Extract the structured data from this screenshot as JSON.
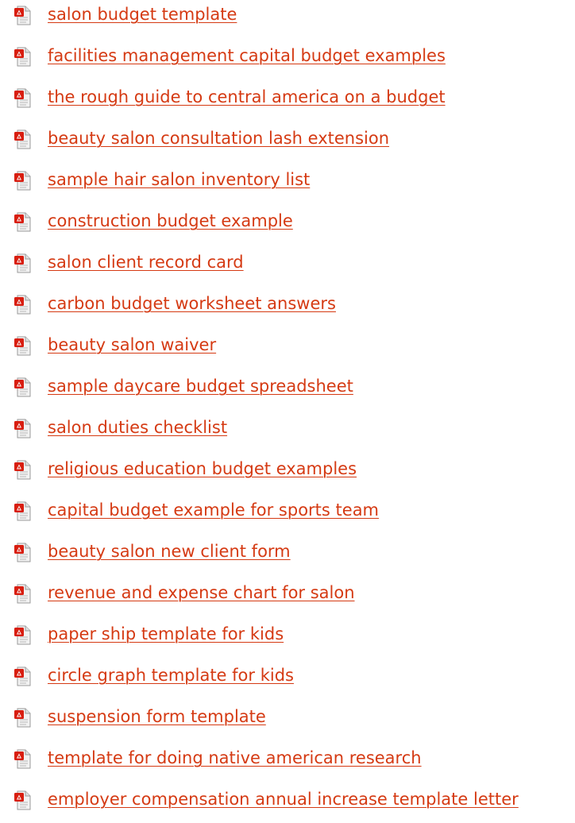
{
  "links": [
    {
      "label": "salon budget template",
      "icon": "pdf-file-icon"
    },
    {
      "label": "facilities management capital budget examples",
      "icon": "pdf-file-icon"
    },
    {
      "label": "the rough guide to central america on a budget",
      "icon": "pdf-file-icon"
    },
    {
      "label": "beauty salon consultation lash extension",
      "icon": "pdf-file-icon"
    },
    {
      "label": "sample hair salon inventory list",
      "icon": "pdf-file-icon"
    },
    {
      "label": "construction budget example",
      "icon": "pdf-file-icon"
    },
    {
      "label": "salon client record card",
      "icon": "pdf-file-icon"
    },
    {
      "label": "carbon budget worksheet answers",
      "icon": "pdf-file-icon"
    },
    {
      "label": "beauty salon waiver",
      "icon": "pdf-file-icon"
    },
    {
      "label": "sample daycare budget spreadsheet",
      "icon": "pdf-file-icon"
    },
    {
      "label": "salon duties checklist",
      "icon": "pdf-file-icon"
    },
    {
      "label": "religious education budget examples",
      "icon": "pdf-file-icon"
    },
    {
      "label": "capital budget example for sports team",
      "icon": "pdf-file-icon"
    },
    {
      "label": "beauty salon new client form",
      "icon": "pdf-file-icon"
    },
    {
      "label": "revenue and expense chart for salon",
      "icon": "pdf-file-icon"
    },
    {
      "label": "paper ship template for kids",
      "icon": "pdf-file-icon"
    },
    {
      "label": "circle graph template for kids",
      "icon": "pdf-file-icon"
    },
    {
      "label": "suspension form template",
      "icon": "pdf-file-icon"
    },
    {
      "label": "template for doing native american research",
      "icon": "pdf-file-icon"
    },
    {
      "label": "employer compensation annual increase template letter",
      "icon": "pdf-file-icon"
    }
  ],
  "colors": {
    "link": "#d53a13",
    "icon_red": "#d81e10",
    "icon_paper": "#f2f2f2",
    "icon_border": "#9a9a9a"
  }
}
